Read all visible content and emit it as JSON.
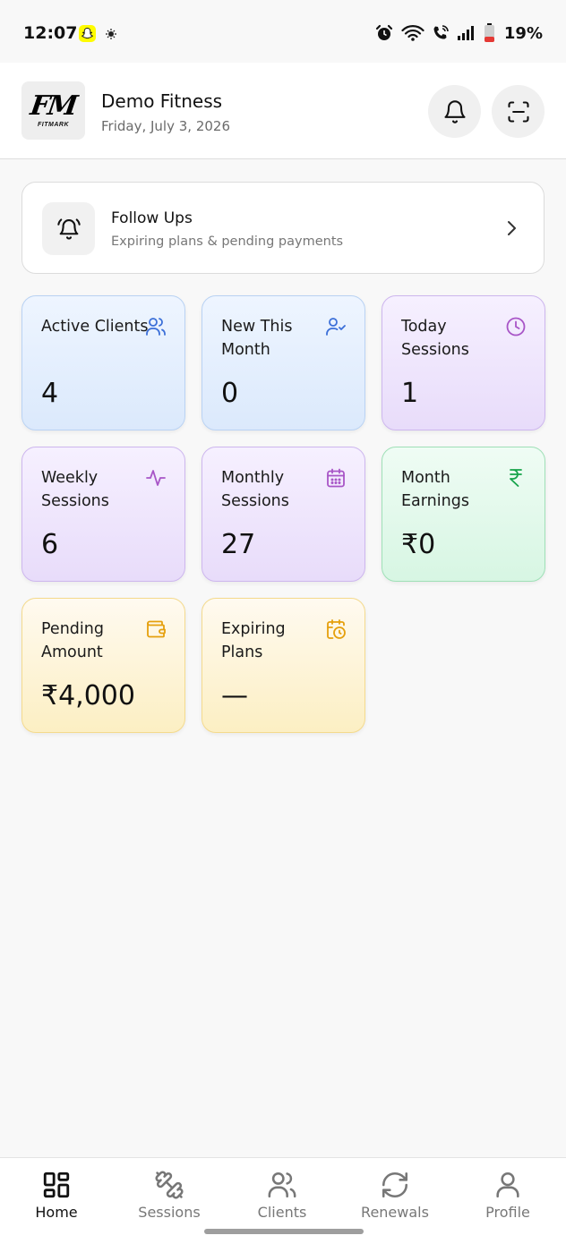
{
  "status_bar": {
    "time": "12:07",
    "battery_percent": "19%",
    "icons": [
      "snapchat-icon",
      "ghost-icon",
      "alarm-icon",
      "wifi-icon",
      "wifi-calling-icon",
      "signal-icon",
      "battery-icon"
    ]
  },
  "header": {
    "logo_mark": "FM",
    "logo_text": "FITMARK",
    "gym_name": "Demo Fitness",
    "date": "Friday, July 3, 2026",
    "actions": [
      "bell-icon",
      "scan-icon"
    ]
  },
  "follow_ups": {
    "title": "Follow Ups",
    "subtitle": "Expiring plans & pending payments",
    "icon": "alarm-bell-icon"
  },
  "stats": [
    {
      "label": "Active Clients",
      "value": "4",
      "icon": "users-icon",
      "accent": "#3b6fd8"
    },
    {
      "label": "New This Month",
      "value": "0",
      "icon": "user-check-icon",
      "accent": "#3b6fd8"
    },
    {
      "label": "Today Sessions",
      "value": "1",
      "icon": "clock-icon",
      "accent": "#a855c7"
    },
    {
      "label": "Weekly Sessions",
      "value": "6",
      "icon": "activity-icon",
      "accent": "#a855c7"
    },
    {
      "label": "Monthly Sessions",
      "value": "27",
      "icon": "calendar-icon",
      "accent": "#a855c7"
    },
    {
      "label": "Month Earnings",
      "value": "₹0",
      "icon": "rupee-icon",
      "accent": "#16a34a"
    },
    {
      "label": "Pending Amount",
      "value": "₹4,000",
      "icon": "wallet-icon",
      "accent": "#e5a00d"
    },
    {
      "label": "Expiring Plans",
      "value": "—",
      "icon": "calendar-clock-icon",
      "accent": "#e5a00d"
    }
  ],
  "nav": {
    "items": [
      {
        "label": "Home",
        "icon": "home-grid-icon",
        "active": true
      },
      {
        "label": "Sessions",
        "icon": "dumbbell-icon",
        "active": false
      },
      {
        "label": "Clients",
        "icon": "users-icon",
        "active": false
      },
      {
        "label": "Renewals",
        "icon": "refresh-icon",
        "active": false
      },
      {
        "label": "Profile",
        "icon": "user-icon",
        "active": false
      }
    ]
  }
}
